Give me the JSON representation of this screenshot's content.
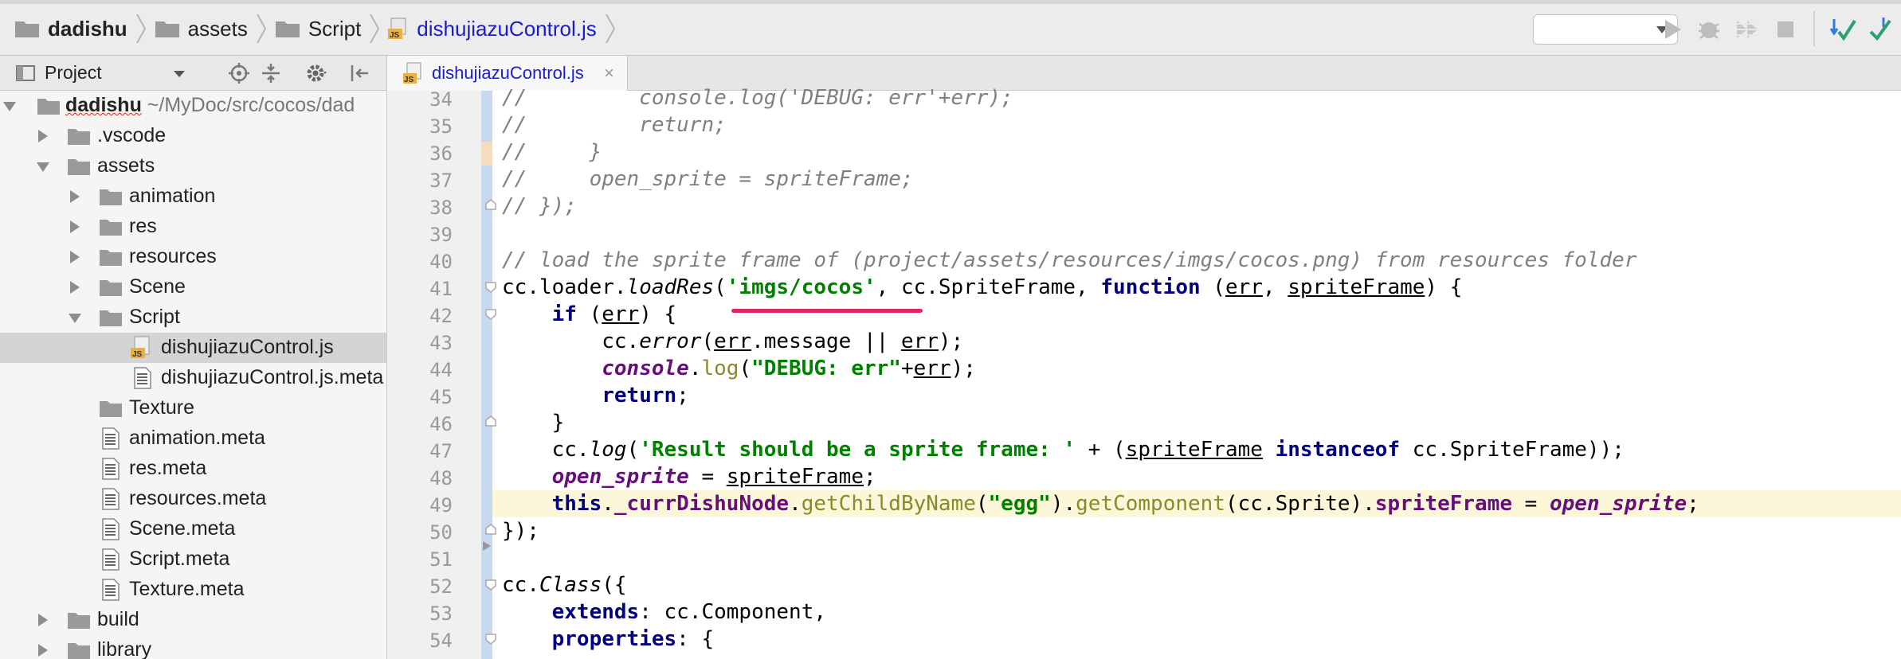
{
  "navbar": {
    "crumbs": [
      "dadishu",
      "assets",
      "Script",
      "dishujiazuControl.js"
    ],
    "icons": [
      "run-icon",
      "debug-icon",
      "coverage-icon",
      "stop-icon",
      "vcs-update-icon",
      "vcs-commit-icon"
    ]
  },
  "project_panel": {
    "title": "Project",
    "tree": [
      {
        "label": "dadishu",
        "path": "~/MyDoc/src/cocos/dad"
      },
      {
        "label": ".vscode"
      },
      {
        "label": "assets"
      },
      {
        "label": "animation"
      },
      {
        "label": "res"
      },
      {
        "label": "resources"
      },
      {
        "label": "Scene"
      },
      {
        "label": "Script"
      },
      {
        "label": "dishujiazuControl.js"
      },
      {
        "label": "dishujiazuControl.js.meta"
      },
      {
        "label": "Texture"
      },
      {
        "label": "animation.meta"
      },
      {
        "label": "res.meta"
      },
      {
        "label": "resources.meta"
      },
      {
        "label": "Scene.meta"
      },
      {
        "label": "Script.meta"
      },
      {
        "label": "Texture.meta"
      },
      {
        "label": "build"
      },
      {
        "label": "library"
      }
    ]
  },
  "editor": {
    "tab_label": "dishujiazuControl.js",
    "tab_close": "×",
    "line_numbers": [
      "34",
      "35",
      "36",
      "37",
      "38",
      "39",
      "40",
      "41",
      "42",
      "43",
      "44",
      "45",
      "46",
      "47",
      "48",
      "49",
      "50",
      "51",
      "52",
      "53",
      "54"
    ],
    "code": {
      "l34_comment": "//         console.log('DEBUG: err'+err);",
      "l35_comment": "//         return;",
      "l36_comment": "//     }",
      "l37_comment": "//     open_sprite = spriteFrame;",
      "l38_comment": "// });",
      "l40_comment": "// load the sprite frame of (project/assets/resources/imgs/cocos.png) from resources folder",
      "cc": "cc",
      "dot": ".",
      "loader": "loader",
      "loadRes": "loadRes",
      "open_paren": "(",
      "str_imgs": "'imgs/cocos'",
      "comma_sp": ", ",
      "cc_spriteframe": "cc.SpriteFrame",
      "kw_function": "function",
      "sp_paren": " (",
      "err": "err",
      "spriteFrame": "spriteFrame",
      "paren_brace": ") {",
      "indent4": "    ",
      "indent8": "        ",
      "kw_if": "if",
      "error": "error",
      "message_or": ".message || ",
      "close_semi": ");",
      "console": "console",
      "log": "log",
      "str_debug": "\"DEBUG: err\"",
      "plus": "+",
      "kw_return": "return",
      "semi": ";",
      "close_brace": "}",
      "str_result": "'Result should be a sprite frame: '",
      "plus_paren": " + (",
      "kw_instanceof": "instanceof",
      "sp": " ",
      "close_two": "));",
      "open_sprite": "open_sprite",
      "assign": " = ",
      "kw_this": "this",
      "currDishuNode": "_currDishuNode",
      "getChildByName": "getChildByName",
      "str_egg": "\"egg\"",
      "close_dot": ").",
      "getComponent": "getComponent",
      "cc_sprite": "cc.Sprite",
      "spriteFrame_prop": "spriteFrame",
      "end_fn": "});",
      "class_kw": "Class",
      "open_brace_paren": "({",
      "extends": "extends",
      "colon_sp": ": ",
      "cc_component": "cc.Component,",
      "properties": "properties",
      "open_brace": "{"
    }
  }
}
